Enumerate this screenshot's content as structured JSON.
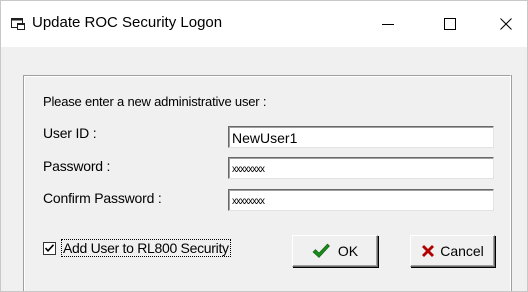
{
  "window": {
    "title": "Update ROC Security Logon",
    "icon": "app-window-icon",
    "caption_buttons": [
      "minimize-icon",
      "maximize-icon",
      "close-icon"
    ]
  },
  "form": {
    "instructions": "Please enter a new administrative user :",
    "user_id": {
      "label": "User ID :",
      "value": "NewUser1"
    },
    "password": {
      "label": "Password :",
      "value": "xxxxxxxx"
    },
    "confirm_password": {
      "label": "Confirm Password :",
      "value": "xxxxxxxx"
    },
    "add_user_checkbox": {
      "label": "Add User to RL800 Security",
      "checked": true
    }
  },
  "buttons": {
    "ok": {
      "label": "OK",
      "icon": "checkmark-icon",
      "icon_color": "#1a8a1a"
    },
    "cancel": {
      "label": "Cancel",
      "icon": "x-mark-icon",
      "icon_color": "#b00000"
    }
  }
}
